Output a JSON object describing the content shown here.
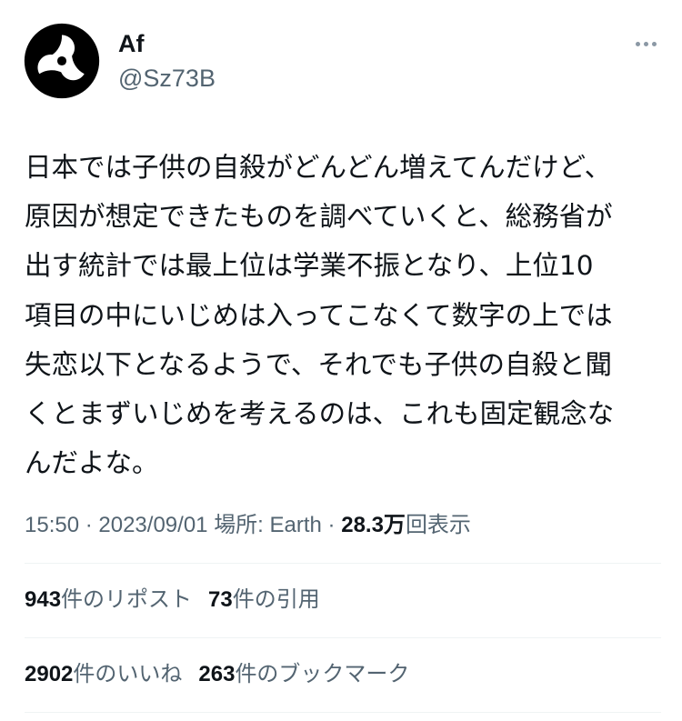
{
  "author": {
    "display_name": "Af",
    "handle": "@Sz73B",
    "avatar_icon": "tomoe-icon"
  },
  "more_icon": "more-options-icon",
  "tweet": {
    "lines": [
      "日本では子供の自殺がどんどん増えてんだけど、",
      "原因が想定できたものを調べていくと、総務省が",
      "出す統計では最上位は学業不振となり、上位10",
      "項目の中にいじめは入ってこなくて数字の上では",
      "失恋以下となるようで、それでも子供の自殺と聞",
      "くとまずいじめを考えるのは、これも固定観念な",
      "んだよな。"
    ]
  },
  "meta": {
    "time": "15:50",
    "separator": " · ",
    "date": "2023/09/01",
    "location_label": "場所: Earth",
    "views_count": "28.3万",
    "views_label": "回表示"
  },
  "stats": {
    "reposts": {
      "count": "943",
      "label": "件のリポスト"
    },
    "quotes": {
      "count": "73",
      "label": "件の引用"
    },
    "likes": {
      "count": "2902",
      "label": "件のいいね"
    },
    "bookmarks": {
      "count": "263",
      "label": "件のブックマーク"
    }
  },
  "colors": {
    "text": "#0f1419",
    "secondary": "#536471",
    "divider": "#eff3f4"
  }
}
